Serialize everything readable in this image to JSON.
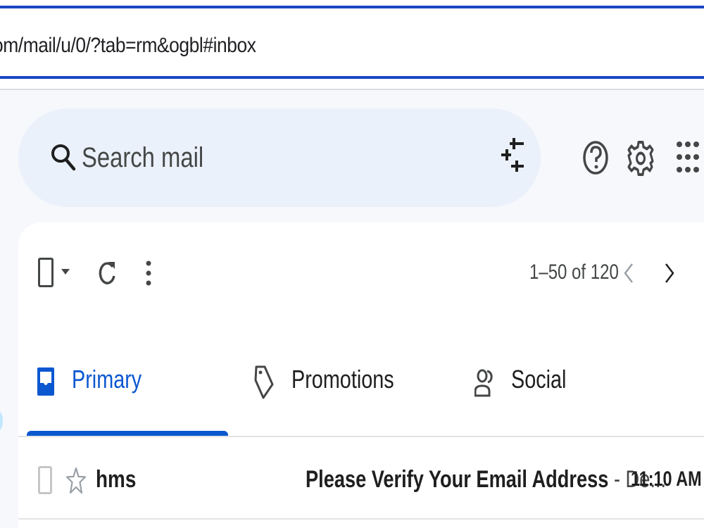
{
  "browser": {
    "url": "om/mail/u/0/?tab=rm&ogbl#inbox"
  },
  "search": {
    "placeholder": "Search mail"
  },
  "toolbar": {
    "page_range": "1–50 of 120"
  },
  "tabs": [
    {
      "label": "Primary",
      "active": true
    },
    {
      "label": "Promotions",
      "active": false
    },
    {
      "label": "Social",
      "active": false
    }
  ],
  "messages": [
    {
      "sender": "hms",
      "subject": "Please Verify Your Email Address",
      "snippet": " - De...",
      "time": "11:10 AM",
      "unread": true,
      "starred": false
    }
  ],
  "icons": {
    "search": "search-icon",
    "filter": "tune-icon",
    "help": "help-icon",
    "settings": "gear-icon",
    "apps": "apps-grid-icon"
  },
  "colors": {
    "accent": "#0b57d0",
    "url_border": "#1a47c2",
    "search_bg": "#eaf1fb",
    "page_bg": "#f6f8fc"
  }
}
